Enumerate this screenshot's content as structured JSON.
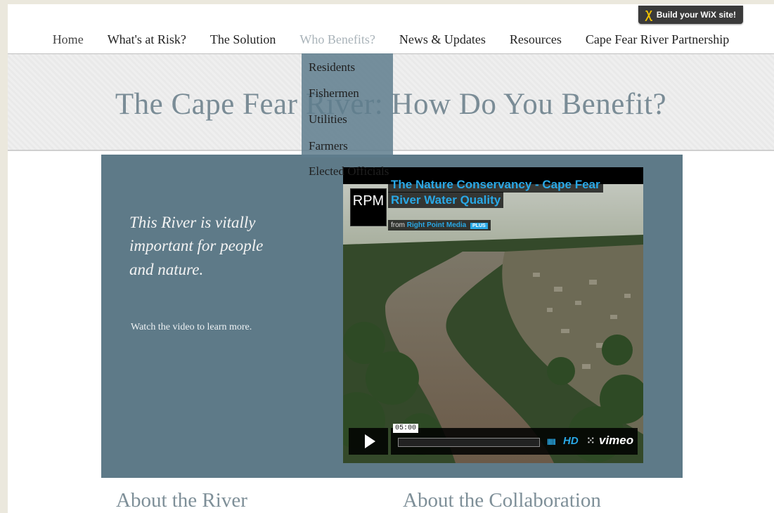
{
  "wix_banner": {
    "icon": "wix-x-icon",
    "label": "Build your WiX site!"
  },
  "nav": {
    "items": [
      {
        "label": "Home"
      },
      {
        "label": "What's at Risk?"
      },
      {
        "label": "The Solution"
      },
      {
        "label": "Who Benefits?",
        "active": true
      },
      {
        "label": "News & Updates"
      },
      {
        "label": "Resources"
      },
      {
        "label": "Cape Fear River Partnership"
      }
    ]
  },
  "dropdown": {
    "items": [
      "Residents",
      "Fishermen",
      "Utilities",
      "Farmers",
      "Elected Officials"
    ]
  },
  "page_title": "The Cape Fear River: How Do You Benefit?",
  "hero": {
    "quote": "This River is vitally important for people and nature.",
    "sub": "Watch the video to learn more."
  },
  "video": {
    "logo": "RPM",
    "title": "The Nature Conservancy - Cape Fear River Water Quality",
    "byline_prefix": "from",
    "byline_author": "Right Point Media",
    "plus_badge": "PLUS",
    "duration": "05:00",
    "hd_label": "HD",
    "brand": "vimeo",
    "icons": [
      "play-icon",
      "volume-icon",
      "fullscreen-icon"
    ]
  },
  "sections": {
    "left_heading": "About the River",
    "right_heading": "About the Collaboration"
  },
  "colors": {
    "hero_bg": "#5e7a88",
    "title": "#7a8c96",
    "vimeo_blue": "#29a8e6",
    "dropdown_bg": "#5e7d8d"
  }
}
